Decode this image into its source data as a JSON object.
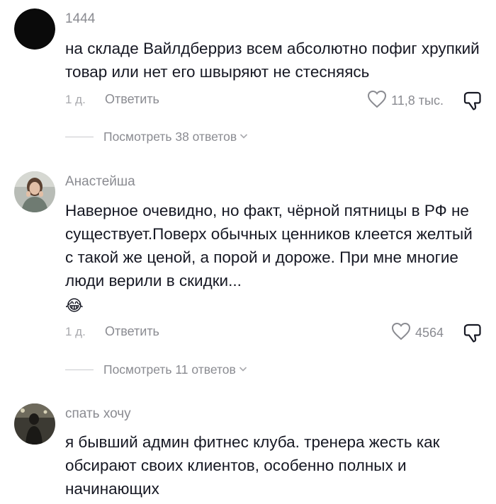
{
  "comments": [
    {
      "author": "1444",
      "text": "на складе Вайлдберриз всем абсолютно пофиг хрупкий товар или нет его швыряют не стесняясь",
      "time": "1 д.",
      "reply_label": "Ответить",
      "likes": "11,8 тыс.",
      "view_replies": "Посмотреть 38 ответов",
      "avatar_icon": "black-circle-avatar"
    },
    {
      "author": "Анастейша",
      "text": "Наверное очевидно, но факт, чёрной пятницы в РФ не существует.Поверх обычных ценников клеется желтый с такой же ценой, а порой и дороже. При мне многие люди верили в скидки...",
      "emoji": "😂",
      "time": "1 д.",
      "reply_label": "Ответить",
      "likes": "4564",
      "view_replies": "Посмотреть 11 ответов",
      "avatar_icon": "photo-avatar"
    },
    {
      "author": "спать хочу",
      "text": "я бывший админ фитнес клуба. тренера жесть как обсирают своих клиентов, особенно полных и начинающих",
      "avatar_icon": "photo-avatar"
    }
  ],
  "colors": {
    "text": "#161823",
    "muted": "#8a8b91",
    "light": "#a8a9ad"
  }
}
